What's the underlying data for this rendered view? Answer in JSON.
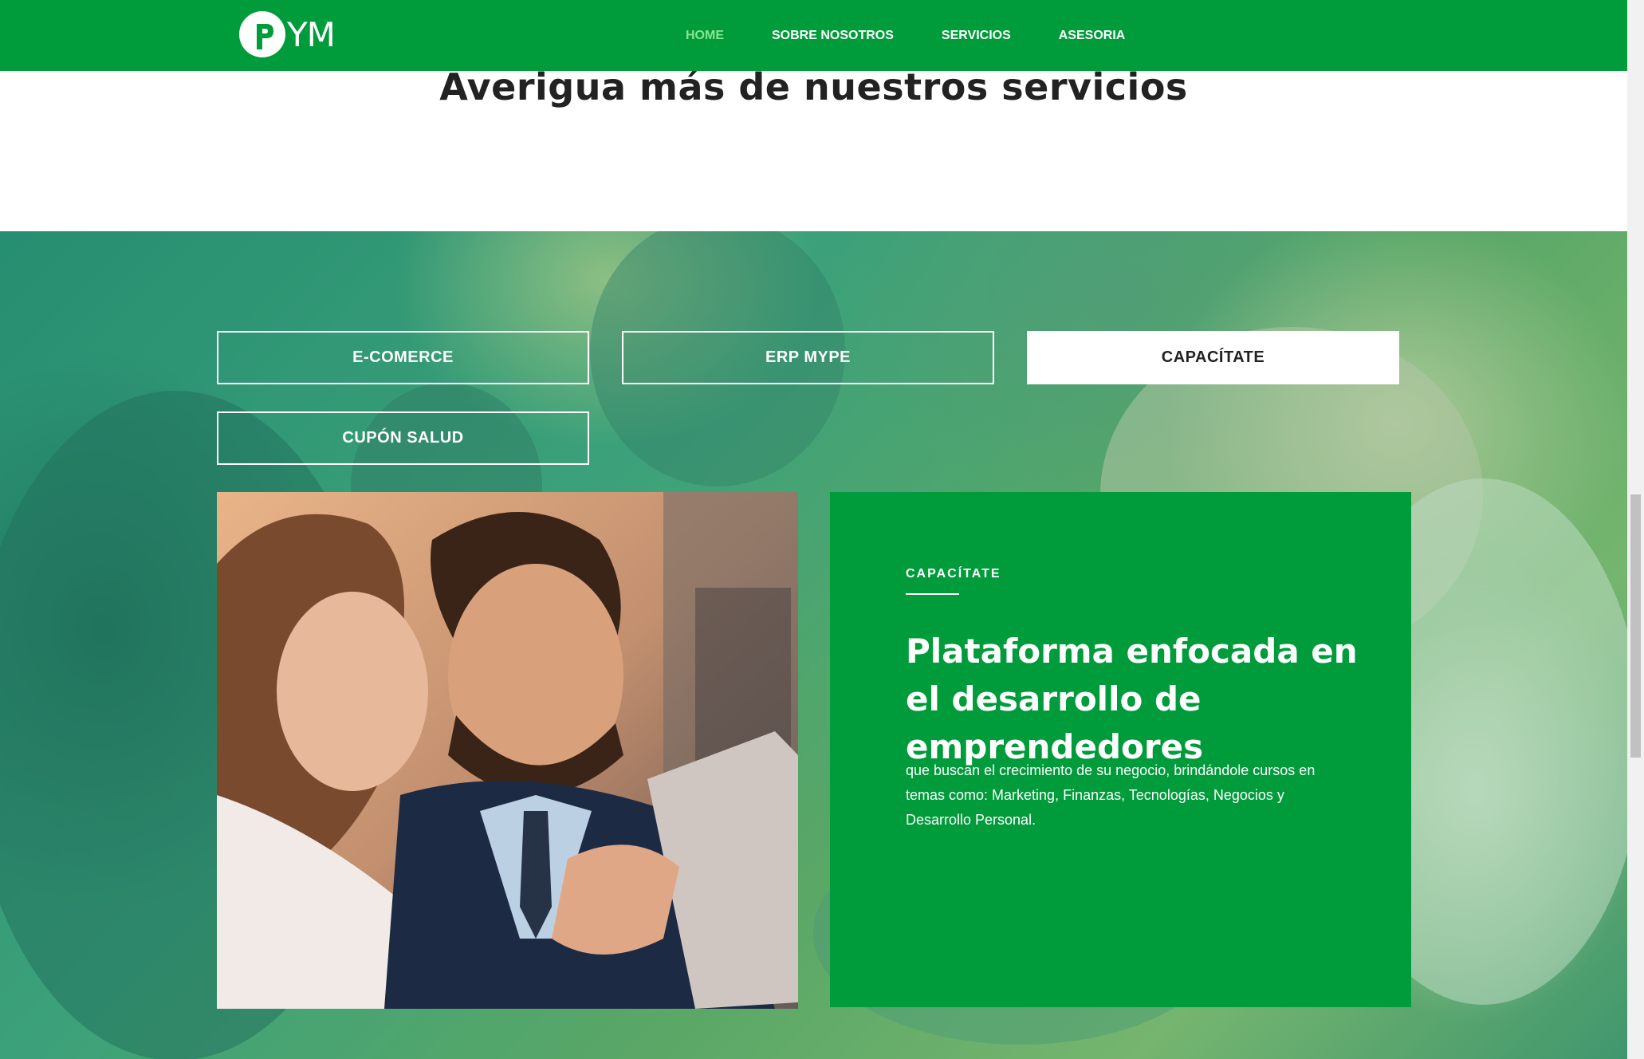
{
  "brand": {
    "logo_text": "YM",
    "logo_letter": "P"
  },
  "nav": {
    "items": [
      {
        "label": "HOME",
        "active": true
      },
      {
        "label": "SOBRE NOSOTROS"
      },
      {
        "label": "SERVICIOS"
      },
      {
        "label": "ASESORIA"
      }
    ]
  },
  "section": {
    "title": "Averigua más de nuestros servicios"
  },
  "tabs": [
    {
      "label": "E-COMERCE"
    },
    {
      "label": "ERP MYPE"
    },
    {
      "label": "CAPACÍTATE",
      "active": true
    },
    {
      "label": "CUPÓN SALUD"
    }
  ],
  "card": {
    "eyebrow": "CAPACÍTATE",
    "title": "Plataforma enfocada en el desarrollo de emprendedores",
    "text": "que buscan el crecimiento de su negocio, brindándole cursos en temas como: Marketing, Finanzas, Tecnologías, Negocios y Desarrollo Personal."
  },
  "colors": {
    "brand_green": "#009b3a",
    "nav_active": "#8be68b",
    "white": "#ffffff"
  },
  "icons": {
    "logo": "pym-logo-icon"
  }
}
